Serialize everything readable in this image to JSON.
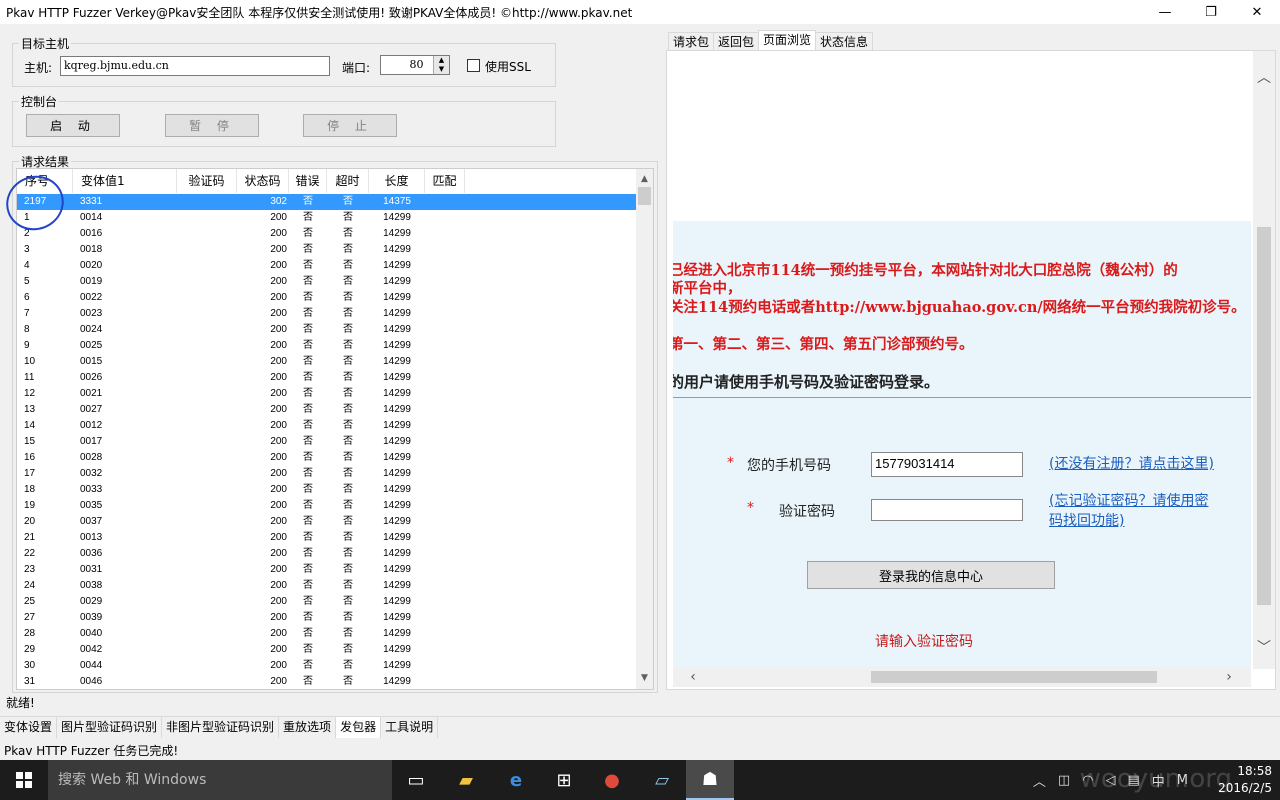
{
  "window": {
    "title": "Pkav HTTP Fuzzer   Verkey@Pkav安全团队  本程序仅供安全测试使用!  致谢PKAV全体成员! ©http://www.pkav.net",
    "min": "—",
    "max": "❐",
    "close": "✕"
  },
  "target": {
    "legend": "目标主机",
    "host_label": "主机:",
    "host_value": "kqreg.bjmu.edu.cn",
    "port_label": "端口:",
    "port_value": "80",
    "ssl_label": "使用SSL"
  },
  "console": {
    "legend": "控制台",
    "start": "启 动",
    "pause": "暂 停",
    "stop": "停 止"
  },
  "results": {
    "legend": "请求结果",
    "columns": [
      "序号",
      "变体值1",
      "验证码",
      "状态码",
      "错误",
      "超时",
      "长度",
      "匹配"
    ],
    "rows": [
      [
        "2197",
        "3331",
        "",
        "302",
        "否",
        "否",
        "14375",
        ""
      ],
      [
        "1",
        "0014",
        "",
        "200",
        "否",
        "否",
        "14299",
        ""
      ],
      [
        "2",
        "0016",
        "",
        "200",
        "否",
        "否",
        "14299",
        ""
      ],
      [
        "3",
        "0018",
        "",
        "200",
        "否",
        "否",
        "14299",
        ""
      ],
      [
        "4",
        "0020",
        "",
        "200",
        "否",
        "否",
        "14299",
        ""
      ],
      [
        "5",
        "0019",
        "",
        "200",
        "否",
        "否",
        "14299",
        ""
      ],
      [
        "6",
        "0022",
        "",
        "200",
        "否",
        "否",
        "14299",
        ""
      ],
      [
        "7",
        "0023",
        "",
        "200",
        "否",
        "否",
        "14299",
        ""
      ],
      [
        "8",
        "0024",
        "",
        "200",
        "否",
        "否",
        "14299",
        ""
      ],
      [
        "9",
        "0025",
        "",
        "200",
        "否",
        "否",
        "14299",
        ""
      ],
      [
        "10",
        "0015",
        "",
        "200",
        "否",
        "否",
        "14299",
        ""
      ],
      [
        "11",
        "0026",
        "",
        "200",
        "否",
        "否",
        "14299",
        ""
      ],
      [
        "12",
        "0021",
        "",
        "200",
        "否",
        "否",
        "14299",
        ""
      ],
      [
        "13",
        "0027",
        "",
        "200",
        "否",
        "否",
        "14299",
        ""
      ],
      [
        "14",
        "0012",
        "",
        "200",
        "否",
        "否",
        "14299",
        ""
      ],
      [
        "15",
        "0017",
        "",
        "200",
        "否",
        "否",
        "14299",
        ""
      ],
      [
        "16",
        "0028",
        "",
        "200",
        "否",
        "否",
        "14299",
        ""
      ],
      [
        "17",
        "0032",
        "",
        "200",
        "否",
        "否",
        "14299",
        ""
      ],
      [
        "18",
        "0033",
        "",
        "200",
        "否",
        "否",
        "14299",
        ""
      ],
      [
        "19",
        "0035",
        "",
        "200",
        "否",
        "否",
        "14299",
        ""
      ],
      [
        "20",
        "0037",
        "",
        "200",
        "否",
        "否",
        "14299",
        ""
      ],
      [
        "21",
        "0013",
        "",
        "200",
        "否",
        "否",
        "14299",
        ""
      ],
      [
        "22",
        "0036",
        "",
        "200",
        "否",
        "否",
        "14299",
        ""
      ],
      [
        "23",
        "0031",
        "",
        "200",
        "否",
        "否",
        "14299",
        ""
      ],
      [
        "24",
        "0038",
        "",
        "200",
        "否",
        "否",
        "14299",
        ""
      ],
      [
        "25",
        "0029",
        "",
        "200",
        "否",
        "否",
        "14299",
        ""
      ],
      [
        "27",
        "0039",
        "",
        "200",
        "否",
        "否",
        "14299",
        ""
      ],
      [
        "28",
        "0040",
        "",
        "200",
        "否",
        "否",
        "14299",
        ""
      ],
      [
        "29",
        "0042",
        "",
        "200",
        "否",
        "否",
        "14299",
        ""
      ],
      [
        "30",
        "0044",
        "",
        "200",
        "否",
        "否",
        "14299",
        ""
      ],
      [
        "31",
        "0046",
        "",
        "200",
        "否",
        "否",
        "14299",
        ""
      ]
    ]
  },
  "status": {
    "ready": "就绪!",
    "task": "Pkav HTTP Fuzzer 任务已完成!"
  },
  "bottom_tabs": [
    "变体设置",
    "图片型验证码识别",
    "非图片型验证码识别",
    "重放选项",
    "发包器",
    "工具说明"
  ],
  "bottom_active": 4,
  "right_tabs": [
    "请求包",
    "返回包",
    "页面浏览",
    "状态信息"
  ],
  "right_active": 2,
  "web": {
    "line1": "已经进入北京市114统一预约挂号平台，本网站针对北大口腔总院（魏公村）的",
    "line2": "新平台中，",
    "line3": "关注114预约电话或者http://www.bjguahao.gov.cn/网络统一平台预约我院初诊号。",
    "line4": "第一、第二、第三、第四、第五门诊部预约号。",
    "line5": "的用户请使用手机号码及验证密码登录。",
    "star": "*",
    "phone_label": "您的手机号码",
    "phone_value": "15779031414",
    "register_link": "(还没有注册？请点击这里)",
    "code_label": "验证密码",
    "forgot_link_1": "(忘记验证密码？请使用密",
    "forgot_link_2": "码找回功能)",
    "login_button": "登录我的信息中心",
    "error_text": "请输入验证密码"
  },
  "taskbar": {
    "search_placeholder": "搜索 Web 和 Windows",
    "time": "18:58",
    "date": "2016/2/5",
    "watermark": "wooyun.org",
    "ime": "中",
    "ime2": "M"
  }
}
